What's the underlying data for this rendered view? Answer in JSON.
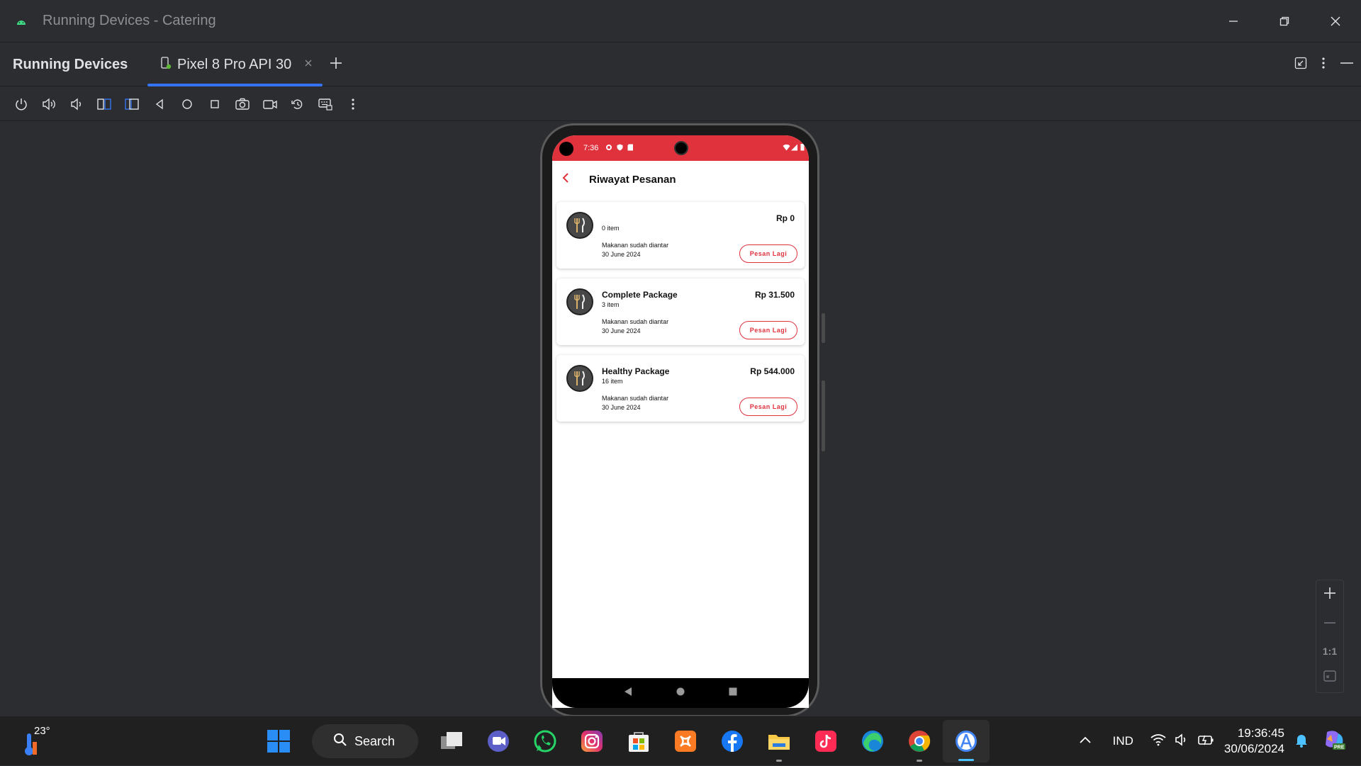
{
  "window": {
    "title": "Running Devices - Catering"
  },
  "tool_window": {
    "title": "Running Devices"
  },
  "tabs": [
    {
      "label": "Pixel 8 Pro API 30"
    }
  ],
  "status_bar": {
    "time": "7:36"
  },
  "app": {
    "page_title": "Riwayat Pesanan",
    "accent_color": "#e0323d",
    "orders": [
      {
        "name": "",
        "items": "0 item",
        "price": "Rp 0",
        "status": "Makanan sudah diantar",
        "date": "30 June 2024",
        "button": "Pesan Lagi"
      },
      {
        "name": "Complete Package",
        "items": "3 item",
        "price": "Rp 31.500",
        "status": "Makanan sudah diantar",
        "date": "30 June 2024",
        "button": "Pesan Lagi"
      },
      {
        "name": "Healthy Package",
        "items": "16 item",
        "price": "Rp 544.000",
        "status": "Makanan sudah diantar",
        "date": "30 June 2024",
        "button": "Pesan Lagi"
      }
    ]
  },
  "zoom": {
    "one_to_one": "1:1"
  },
  "taskbar": {
    "weather_temp": "23°",
    "search_label": "Search",
    "language": "IND",
    "time": "19:36:45",
    "date": "30/06/2024"
  }
}
